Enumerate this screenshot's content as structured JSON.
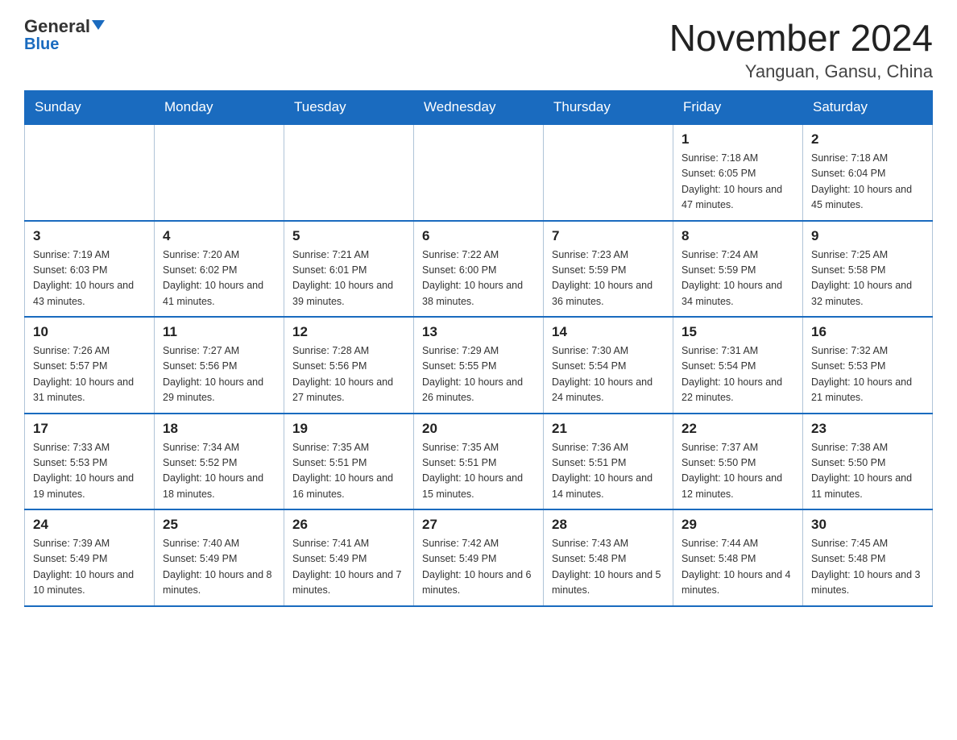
{
  "header": {
    "logo_general": "General",
    "logo_blue": "Blue",
    "month_title": "November 2024",
    "location": "Yanguan, Gansu, China"
  },
  "days_of_week": [
    "Sunday",
    "Monday",
    "Tuesday",
    "Wednesday",
    "Thursday",
    "Friday",
    "Saturday"
  ],
  "weeks": [
    [
      {
        "day": "",
        "info": ""
      },
      {
        "day": "",
        "info": ""
      },
      {
        "day": "",
        "info": ""
      },
      {
        "day": "",
        "info": ""
      },
      {
        "day": "",
        "info": ""
      },
      {
        "day": "1",
        "info": "Sunrise: 7:18 AM\nSunset: 6:05 PM\nDaylight: 10 hours and 47 minutes."
      },
      {
        "day": "2",
        "info": "Sunrise: 7:18 AM\nSunset: 6:04 PM\nDaylight: 10 hours and 45 minutes."
      }
    ],
    [
      {
        "day": "3",
        "info": "Sunrise: 7:19 AM\nSunset: 6:03 PM\nDaylight: 10 hours and 43 minutes."
      },
      {
        "day": "4",
        "info": "Sunrise: 7:20 AM\nSunset: 6:02 PM\nDaylight: 10 hours and 41 minutes."
      },
      {
        "day": "5",
        "info": "Sunrise: 7:21 AM\nSunset: 6:01 PM\nDaylight: 10 hours and 39 minutes."
      },
      {
        "day": "6",
        "info": "Sunrise: 7:22 AM\nSunset: 6:00 PM\nDaylight: 10 hours and 38 minutes."
      },
      {
        "day": "7",
        "info": "Sunrise: 7:23 AM\nSunset: 5:59 PM\nDaylight: 10 hours and 36 minutes."
      },
      {
        "day": "8",
        "info": "Sunrise: 7:24 AM\nSunset: 5:59 PM\nDaylight: 10 hours and 34 minutes."
      },
      {
        "day": "9",
        "info": "Sunrise: 7:25 AM\nSunset: 5:58 PM\nDaylight: 10 hours and 32 minutes."
      }
    ],
    [
      {
        "day": "10",
        "info": "Sunrise: 7:26 AM\nSunset: 5:57 PM\nDaylight: 10 hours and 31 minutes."
      },
      {
        "day": "11",
        "info": "Sunrise: 7:27 AM\nSunset: 5:56 PM\nDaylight: 10 hours and 29 minutes."
      },
      {
        "day": "12",
        "info": "Sunrise: 7:28 AM\nSunset: 5:56 PM\nDaylight: 10 hours and 27 minutes."
      },
      {
        "day": "13",
        "info": "Sunrise: 7:29 AM\nSunset: 5:55 PM\nDaylight: 10 hours and 26 minutes."
      },
      {
        "day": "14",
        "info": "Sunrise: 7:30 AM\nSunset: 5:54 PM\nDaylight: 10 hours and 24 minutes."
      },
      {
        "day": "15",
        "info": "Sunrise: 7:31 AM\nSunset: 5:54 PM\nDaylight: 10 hours and 22 minutes."
      },
      {
        "day": "16",
        "info": "Sunrise: 7:32 AM\nSunset: 5:53 PM\nDaylight: 10 hours and 21 minutes."
      }
    ],
    [
      {
        "day": "17",
        "info": "Sunrise: 7:33 AM\nSunset: 5:53 PM\nDaylight: 10 hours and 19 minutes."
      },
      {
        "day": "18",
        "info": "Sunrise: 7:34 AM\nSunset: 5:52 PM\nDaylight: 10 hours and 18 minutes."
      },
      {
        "day": "19",
        "info": "Sunrise: 7:35 AM\nSunset: 5:51 PM\nDaylight: 10 hours and 16 minutes."
      },
      {
        "day": "20",
        "info": "Sunrise: 7:35 AM\nSunset: 5:51 PM\nDaylight: 10 hours and 15 minutes."
      },
      {
        "day": "21",
        "info": "Sunrise: 7:36 AM\nSunset: 5:51 PM\nDaylight: 10 hours and 14 minutes."
      },
      {
        "day": "22",
        "info": "Sunrise: 7:37 AM\nSunset: 5:50 PM\nDaylight: 10 hours and 12 minutes."
      },
      {
        "day": "23",
        "info": "Sunrise: 7:38 AM\nSunset: 5:50 PM\nDaylight: 10 hours and 11 minutes."
      }
    ],
    [
      {
        "day": "24",
        "info": "Sunrise: 7:39 AM\nSunset: 5:49 PM\nDaylight: 10 hours and 10 minutes."
      },
      {
        "day": "25",
        "info": "Sunrise: 7:40 AM\nSunset: 5:49 PM\nDaylight: 10 hours and 8 minutes."
      },
      {
        "day": "26",
        "info": "Sunrise: 7:41 AM\nSunset: 5:49 PM\nDaylight: 10 hours and 7 minutes."
      },
      {
        "day": "27",
        "info": "Sunrise: 7:42 AM\nSunset: 5:49 PM\nDaylight: 10 hours and 6 minutes."
      },
      {
        "day": "28",
        "info": "Sunrise: 7:43 AM\nSunset: 5:48 PM\nDaylight: 10 hours and 5 minutes."
      },
      {
        "day": "29",
        "info": "Sunrise: 7:44 AM\nSunset: 5:48 PM\nDaylight: 10 hours and 4 minutes."
      },
      {
        "day": "30",
        "info": "Sunrise: 7:45 AM\nSunset: 5:48 PM\nDaylight: 10 hours and 3 minutes."
      }
    ]
  ]
}
